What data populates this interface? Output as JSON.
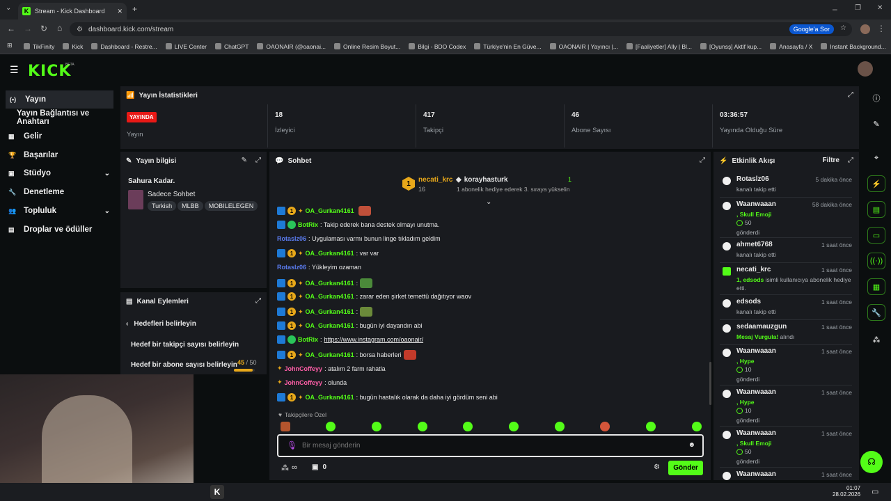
{
  "browser": {
    "tab_title": "Stream - Kick Dashboard",
    "url": "dashboard.kick.com/stream",
    "google_button": "Google'a Sor",
    "bookmarks": [
      "TikFinity",
      "Kick",
      "Dashboard - Restre...",
      "LIVE Center",
      "ChatGPT",
      "OAONAIR (@oaonai...",
      "Online Resim Boyut...",
      "Bilgi - BDO Codex",
      "Türkiye'nin En Güve...",
      "OAONAIR | Yayıncı |...",
      "[Faaliyetler] Ally | Bl...",
      "[Oyunsş] Aktif kup...",
      "Anasayfa / X",
      "Instant Background..."
    ]
  },
  "header": {
    "logo": "KICK",
    "beta": "BETA"
  },
  "sidebar": {
    "items": [
      {
        "label": "Yayın",
        "icon": "broadcast-icon"
      },
      {
        "label": "Yayın Bağlantısı ve Anahtarı"
      },
      {
        "label": "Gelir",
        "icon": "money-icon"
      },
      {
        "label": "Başarılar",
        "icon": "trophy-icon"
      },
      {
        "label": "Stüdyo",
        "icon": "studio-icon"
      },
      {
        "label": "Denetleme",
        "icon": "wrench-icon"
      },
      {
        "label": "Topluluk",
        "icon": "people-icon"
      },
      {
        "label": "Droplar ve ödüller",
        "icon": "drops-icon"
      }
    ]
  },
  "stats": {
    "title": "Yayın İstatistikleri",
    "live_badge": "YAYINDA",
    "live_label": "Yayın",
    "viewers": "18",
    "viewers_label": "İzleyici",
    "followers": "417",
    "followers_label": "Takipçi",
    "subs": "46",
    "subs_label": "Abone Sayısı",
    "uptime": "03:36:57",
    "uptime_label": "Yayında Olduğu Süre"
  },
  "stream_info": {
    "title": "Yayın bilgisi",
    "stream_title": "Sahura Kadar.",
    "category": "Sadece Sohbet",
    "tags": [
      "Turkish",
      "MLBB",
      "MOBILELEGEN"
    ]
  },
  "channel_actions": {
    "title": "Kanal Eylemleri",
    "back": "Hedefleri belirleyin",
    "goal1": "Hedef bir takipçi sayısı belirleyin",
    "goal2": "Hedef bir abone sayısı belirleyin",
    "goal2_progress": "45",
    "goal2_total": "/ 50"
  },
  "chat": {
    "title": "Sohbet",
    "pinned_user1": "necati_krc",
    "pinned_user1_count": "16",
    "pinned_user2": "korayhasturk",
    "pinned_user2_count": "1",
    "pinned_desc": "1 abonelik hediye ederek 3. sıraya yükselin",
    "messages": [
      {
        "user": "OA_Gurkan4161",
        "text": ""
      },
      {
        "user": "BotRix",
        "text": ": Takip ederek bana destek olmayı unutma."
      },
      {
        "user": "Rotaslz06",
        "text": ": Uygulaması varmı bunun linge tıkladım geldim"
      },
      {
        "user": "OA_Gurkan4161",
        "text": ": var var"
      },
      {
        "user": "Rotaslz06",
        "text": ": Yükleyim ozaman"
      },
      {
        "user": "OA_Gurkan4161",
        "text": ":"
      },
      {
        "user": "OA_Gurkan4161",
        "text": ": zarar eden şirket temettü dağıtıyor waov"
      },
      {
        "user": "OA_Gurkan4161",
        "text": ":"
      },
      {
        "user": "OA_Gurkan4161",
        "text": ": bugün iyi dayandın abi"
      },
      {
        "user": "BotRix",
        "text": ":"
      },
      {
        "user": "OA_Gurkan4161",
        "text": ": borsa haberleri"
      },
      {
        "user": "JohnCoffeyy",
        "text": ": atalım 2 farm rahatla"
      },
      {
        "user": "JohnCoffeyy",
        "text": ": olunda"
      },
      {
        "user": "OA_Gurkan4161",
        "text": ": bugün hastalık olarak da daha iyi gördüm seni abi"
      }
    ],
    "botrix_link": "https://www.instagram.com/oaonair/",
    "followers_only": "Takipçilere Özel",
    "input_placeholder": "Bir mesaj gönderin",
    "points": "∞",
    "chest_count": "0",
    "send": "Gönder"
  },
  "activity": {
    "title": "Etkinlik Akışı",
    "filter": "Filtre",
    "items": [
      {
        "name": "Rotaslz06",
        "time": "5 dakika önce",
        "desc": "kanalı takip etti"
      },
      {
        "name": "Waanwaaan",
        "time": "58 dakika önce",
        "green": ", Skull Emoji",
        "amount": "50",
        "desc": "gönderdi"
      },
      {
        "name": "ahmet6768",
        "time": "1 saat önce",
        "desc": "kanalı takip etti"
      },
      {
        "name": "necati_krc",
        "time": "1 saat önce",
        "green": "1, edsods",
        "desc": "isimli kullanıcıya abonelik hediye etti."
      },
      {
        "name": "edsods",
        "time": "1 saat önce",
        "desc": "kanalı takip etti"
      },
      {
        "name": "sedaamauzgun",
        "time": "1 saat önce",
        "green": "Mesaj Vurgula!",
        "desc": "alındı"
      },
      {
        "name": "Waanwaaan",
        "time": "1 saat önce",
        "green": ", Hype",
        "amount": "10",
        "desc": "gönderdi"
      },
      {
        "name": "Waanwaaan",
        "time": "1 saat önce",
        "green": ", Hype",
        "amount": "10",
        "desc": "gönderdi"
      },
      {
        "name": "Waanwaaan",
        "time": "1 saat önce",
        "green": ", Skull Emoji",
        "amount": "50",
        "desc": "gönderdi"
      },
      {
        "name": "Waanwaaan",
        "time": "1 saat önce"
      }
    ]
  },
  "taskbar": {
    "time": "01:07",
    "date": "28.02.2026"
  },
  "colors": {
    "brand": "#53fc18",
    "live": "#e91916",
    "panel": "#191b1f"
  }
}
